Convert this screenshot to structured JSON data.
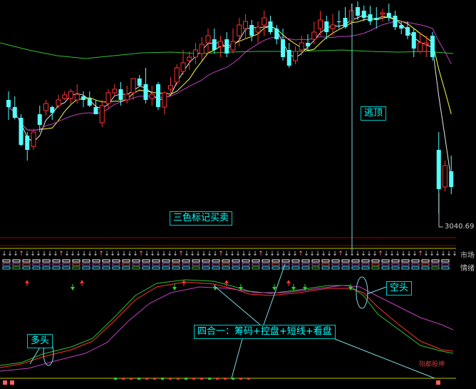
{
  "labels": {
    "escape_top": "逃顶",
    "three_color": "三色标记买卖",
    "four_in_one": "四合一：筹码+控盘+短线+看盘",
    "long": "多头",
    "short": "空头",
    "market": "市场",
    "mood": "情绪",
    "low_price": "3040.69",
    "watermark": "阳都股神"
  },
  "colors": {
    "up_candle": "#ff3232",
    "down_candle": "#54ffff",
    "ma_white": "#e8e8e8",
    "ma_yellow": "#ffff40",
    "ma_magenta": "#c040c0",
    "ma_green": "#30c030",
    "background": "#000000"
  },
  "chart_data": {
    "type": "candlestick",
    "candles": [
      [
        140,
        150,
        168,
        128
      ],
      [
        150,
        165,
        167,
        135
      ],
      [
        165,
        203,
        205,
        160
      ],
      [
        190,
        210,
        225,
        185
      ],
      [
        205,
        185,
        210,
        180
      ],
      [
        160,
        175,
        185,
        148
      ],
      [
        155,
        145,
        162,
        140
      ],
      [
        150,
        158,
        168,
        148
      ],
      [
        148,
        140,
        152,
        133
      ],
      [
        138,
        133,
        140,
        128
      ],
      [
        138,
        128,
        145,
        125
      ],
      [
        140,
        132,
        145,
        118
      ],
      [
        135,
        140,
        150,
        128
      ],
      [
        138,
        148,
        150,
        128
      ],
      [
        150,
        160,
        160,
        140
      ],
      [
        172,
        148,
        178,
        140
      ],
      [
        145,
        130,
        152,
        125
      ],
      [
        130,
        125,
        135,
        118
      ],
      [
        125,
        140,
        148,
        115
      ],
      [
        140,
        132,
        145,
        120
      ],
      [
        130,
        110,
        140,
        110
      ],
      [
        110,
        120,
        122,
        105
      ],
      [
        118,
        140,
        145,
        95
      ],
      [
        138,
        132,
        148,
        120
      ],
      [
        118,
        150,
        154,
        115
      ],
      [
        150,
        130,
        160,
        128
      ],
      [
        125,
        120,
        130,
        108
      ],
      [
        115,
        95,
        120,
        90
      ],
      [
        100,
        88,
        105,
        70
      ],
      [
        85,
        80,
        98,
        72
      ],
      [
        80,
        70,
        90,
        60
      ],
      [
        75,
        62,
        85,
        52
      ],
      [
        60,
        50,
        75,
        40
      ],
      [
        55,
        70,
        75,
        40
      ],
      [
        65,
        58,
        80,
        50
      ],
      [
        55,
        75,
        80,
        45
      ],
      [
        70,
        58,
        75,
        40
      ],
      [
        50,
        35,
        65,
        25
      ],
      [
        40,
        30,
        55,
        20
      ],
      [
        35,
        50,
        58,
        28
      ],
      [
        45,
        38,
        60,
        30
      ],
      [
        35,
        25,
        50,
        15
      ],
      [
        30,
        45,
        48,
        22
      ],
      [
        40,
        55,
        62,
        35
      ],
      [
        55,
        80,
        85,
        40
      ],
      [
        70,
        92,
        95,
        60
      ],
      [
        85,
        72,
        90,
        65
      ],
      [
        70,
        60,
        78,
        50
      ],
      [
        60,
        65,
        70,
        48
      ],
      [
        55,
        45,
        62,
        30
      ],
      [
        40,
        28,
        50,
        15
      ],
      [
        30,
        45,
        55,
        22
      ],
      [
        40,
        35,
        50,
        20
      ],
      [
        30,
        30,
        40,
        15
      ],
      [
        25,
        38,
        40,
        10
      ],
      [
        30,
        15,
        35,
        5
      ],
      [
        10,
        22,
        28,
        2
      ],
      [
        15,
        25,
        30,
        8
      ],
      [
        20,
        30,
        35,
        8
      ],
      [
        25,
        28,
        40,
        10
      ],
      [
        20,
        18,
        30,
        12
      ],
      [
        18,
        25,
        30,
        5
      ],
      [
        22,
        38,
        42,
        15
      ],
      [
        35,
        40,
        48,
        30
      ],
      [
        38,
        50,
        55,
        30
      ],
      [
        45,
        68,
        80,
        40
      ],
      [
        72,
        60,
        75,
        45
      ],
      [
        62,
        60,
        80,
        50
      ],
      [
        50,
        80,
        85,
        45
      ],
      [
        210,
        265,
        300,
        185
      ],
      [
        262,
        232,
        268,
        225
      ],
      [
        240,
        262,
        272,
        218
      ]
    ],
    "price_label": "3040.69"
  }
}
